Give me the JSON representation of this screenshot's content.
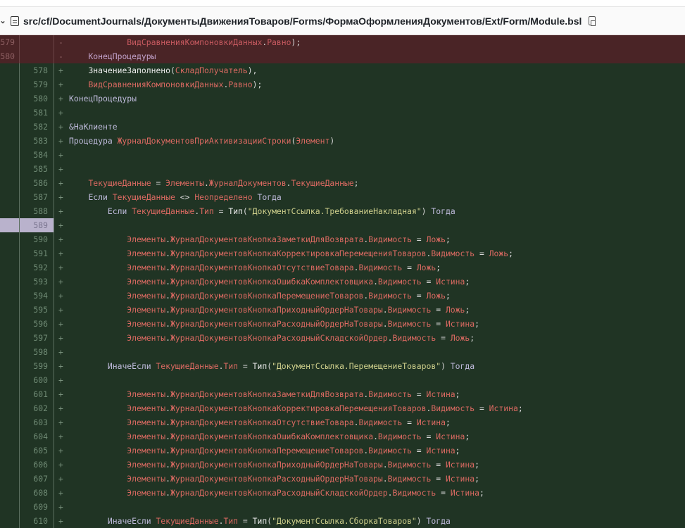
{
  "header": {
    "file_path": "src/cf/DocumentJournals/ДокументыДвиженияТоваров/Forms/ФормаОформленияДокументов/Ext/Form/Module.bsl",
    "icons": [
      "chevron-down-icon",
      "file-icon",
      "copy-icon"
    ]
  },
  "colors": {
    "added_bg": "#203424",
    "deleted_bg": "#4a2426",
    "highlight": "#b9b2cc"
  },
  "lines": [
    {
      "type": "del",
      "old": "579",
      "new": "",
      "sign": "-",
      "indent": 3,
      "tokens": [
        [
          "v",
          "ВидСравненияКомпоновкиДанных"
        ],
        [
          "p",
          "."
        ],
        [
          "v",
          "Равно"
        ],
        [
          "p",
          ");"
        ]
      ]
    },
    {
      "type": "del",
      "old": "580",
      "new": "",
      "sign": "-",
      "indent": 1,
      "tokens": [
        [
          "k",
          "КонецПроцедуры"
        ]
      ]
    },
    {
      "type": "add",
      "old": "",
      "new": "578",
      "sign": "+",
      "indent": 1,
      "tokens": [
        [
          "f",
          "ЗначениеЗаполнено"
        ],
        [
          "p",
          "("
        ],
        [
          "v",
          "СкладПолучатель"
        ],
        [
          "p",
          "),"
        ]
      ]
    },
    {
      "type": "add",
      "old": "",
      "new": "579",
      "sign": "+",
      "indent": 1,
      "tokens": [
        [
          "v",
          "ВидСравненияКомпоновкиДанных"
        ],
        [
          "p",
          "."
        ],
        [
          "v",
          "Равно"
        ],
        [
          "p",
          ");"
        ]
      ]
    },
    {
      "type": "add",
      "old": "",
      "new": "580",
      "sign": "+",
      "indent": 0,
      "tokens": [
        [
          "k",
          "КонецПроцедуры"
        ]
      ]
    },
    {
      "type": "add",
      "old": "",
      "new": "581",
      "sign": "+",
      "indent": 0,
      "tokens": []
    },
    {
      "type": "add",
      "old": "",
      "new": "582",
      "sign": "+",
      "indent": 0,
      "tokens": [
        [
          "k",
          "&НаКлиенте"
        ]
      ]
    },
    {
      "type": "add",
      "old": "",
      "new": "583",
      "sign": "+",
      "indent": 0,
      "tokens": [
        [
          "k",
          "Процедура "
        ],
        [
          "v",
          "ЖурналДокументовПриАктивизацииСтроки"
        ],
        [
          "p",
          "("
        ],
        [
          "v",
          "Элемент"
        ],
        [
          "p",
          ")"
        ]
      ]
    },
    {
      "type": "add",
      "old": "",
      "new": "584",
      "sign": "+",
      "indent": 0,
      "tokens": []
    },
    {
      "type": "add",
      "old": "",
      "new": "585",
      "sign": "+",
      "indent": 0,
      "tokens": []
    },
    {
      "type": "add",
      "old": "",
      "new": "586",
      "sign": "+",
      "indent": 1,
      "tokens": [
        [
          "v",
          "ТекущиеДанные"
        ],
        [
          "p",
          " = "
        ],
        [
          "v",
          "Элементы"
        ],
        [
          "p",
          "."
        ],
        [
          "v",
          "ЖурналДокументов"
        ],
        [
          "p",
          "."
        ],
        [
          "v",
          "ТекущиеДанные"
        ],
        [
          "p",
          ";"
        ]
      ]
    },
    {
      "type": "add",
      "old": "",
      "new": "587",
      "sign": "+",
      "indent": 1,
      "tokens": [
        [
          "k",
          "Если "
        ],
        [
          "v",
          "ТекущиеДанные"
        ],
        [
          "p",
          " <> "
        ],
        [
          "v",
          "Неопределено"
        ],
        [
          "k",
          " Тогда"
        ]
      ]
    },
    {
      "type": "add",
      "old": "",
      "new": "588",
      "sign": "+",
      "indent": 2,
      "tokens": [
        [
          "k",
          "Если "
        ],
        [
          "v",
          "ТекущиеДанные"
        ],
        [
          "p",
          "."
        ],
        [
          "v",
          "Тип"
        ],
        [
          "p",
          " = "
        ],
        [
          "f",
          "Тип"
        ],
        [
          "p",
          "("
        ],
        [
          "s",
          "\"ДокументСсылка.ТребованиеНакладная\""
        ],
        [
          "p",
          ")"
        ],
        [
          "k",
          " Тогда"
        ]
      ]
    },
    {
      "type": "add",
      "hl": true,
      "old": "",
      "new": "589",
      "sign": "+",
      "indent": 0,
      "tokens": []
    },
    {
      "type": "add",
      "old": "",
      "new": "590",
      "sign": "+",
      "indent": 3,
      "tokens": [
        [
          "v",
          "Элементы"
        ],
        [
          "p",
          "."
        ],
        [
          "v",
          "ЖурналДокументовКнопкаЗаметкиДляВозврата"
        ],
        [
          "p",
          "."
        ],
        [
          "v",
          "Видимость"
        ],
        [
          "p",
          " = "
        ],
        [
          "v",
          "Ложь"
        ],
        [
          "p",
          ";"
        ]
      ]
    },
    {
      "type": "add",
      "old": "",
      "new": "591",
      "sign": "+",
      "indent": 3,
      "tokens": [
        [
          "v",
          "Элементы"
        ],
        [
          "p",
          "."
        ],
        [
          "v",
          "ЖурналДокументовКнопкаКорректировкаПеремещенияТоваров"
        ],
        [
          "p",
          "."
        ],
        [
          "v",
          "Видимость"
        ],
        [
          "p",
          " = "
        ],
        [
          "v",
          "Ложь"
        ],
        [
          "p",
          ";"
        ]
      ]
    },
    {
      "type": "add",
      "old": "",
      "new": "592",
      "sign": "+",
      "indent": 3,
      "tokens": [
        [
          "v",
          "Элементы"
        ],
        [
          "p",
          "."
        ],
        [
          "v",
          "ЖурналДокументовКнопкаОтсутствиеТовара"
        ],
        [
          "p",
          "."
        ],
        [
          "v",
          "Видимость"
        ],
        [
          "p",
          " = "
        ],
        [
          "v",
          "Ложь"
        ],
        [
          "p",
          ";"
        ]
      ]
    },
    {
      "type": "add",
      "old": "",
      "new": "593",
      "sign": "+",
      "indent": 3,
      "tokens": [
        [
          "v",
          "Элементы"
        ],
        [
          "p",
          "."
        ],
        [
          "v",
          "ЖурналДокументовКнопкаОшибкаКомплектовщика"
        ],
        [
          "p",
          "."
        ],
        [
          "v",
          "Видимость"
        ],
        [
          "p",
          " = "
        ],
        [
          "v",
          "Истина"
        ],
        [
          "p",
          ";"
        ]
      ]
    },
    {
      "type": "add",
      "old": "",
      "new": "594",
      "sign": "+",
      "indent": 3,
      "tokens": [
        [
          "v",
          "Элементы"
        ],
        [
          "p",
          "."
        ],
        [
          "v",
          "ЖурналДокументовКнопкаПеремещениеТоваров"
        ],
        [
          "p",
          "."
        ],
        [
          "v",
          "Видимость"
        ],
        [
          "p",
          " = "
        ],
        [
          "v",
          "Ложь"
        ],
        [
          "p",
          ";"
        ]
      ]
    },
    {
      "type": "add",
      "old": "",
      "new": "595",
      "sign": "+",
      "indent": 3,
      "tokens": [
        [
          "v",
          "Элементы"
        ],
        [
          "p",
          "."
        ],
        [
          "v",
          "ЖурналДокументовКнопкаПриходныйОрдерНаТовары"
        ],
        [
          "p",
          "."
        ],
        [
          "v",
          "Видимость"
        ],
        [
          "p",
          " = "
        ],
        [
          "v",
          "Ложь"
        ],
        [
          "p",
          ";"
        ]
      ]
    },
    {
      "type": "add",
      "old": "",
      "new": "596",
      "sign": "+",
      "indent": 3,
      "tokens": [
        [
          "v",
          "Элементы"
        ],
        [
          "p",
          "."
        ],
        [
          "v",
          "ЖурналДокументовКнопкаРасходныйОрдерНаТовары"
        ],
        [
          "p",
          "."
        ],
        [
          "v",
          "Видимость"
        ],
        [
          "p",
          " = "
        ],
        [
          "v",
          "Истина"
        ],
        [
          "p",
          ";"
        ]
      ]
    },
    {
      "type": "add",
      "old": "",
      "new": "597",
      "sign": "+",
      "indent": 3,
      "tokens": [
        [
          "v",
          "Элементы"
        ],
        [
          "p",
          "."
        ],
        [
          "v",
          "ЖурналДокументовКнопкаРасходныйСкладскойОрдер"
        ],
        [
          "p",
          "."
        ],
        [
          "v",
          "Видимость"
        ],
        [
          "p",
          " = "
        ],
        [
          "v",
          "Ложь"
        ],
        [
          "p",
          ";"
        ]
      ]
    },
    {
      "type": "add",
      "old": "",
      "new": "598",
      "sign": "+",
      "indent": 0,
      "tokens": []
    },
    {
      "type": "add",
      "old": "",
      "new": "599",
      "sign": "+",
      "indent": 2,
      "tokens": [
        [
          "k",
          "ИначеЕсли "
        ],
        [
          "v",
          "ТекущиеДанные"
        ],
        [
          "p",
          "."
        ],
        [
          "v",
          "Тип"
        ],
        [
          "p",
          " = "
        ],
        [
          "f",
          "Тип"
        ],
        [
          "p",
          "("
        ],
        [
          "s",
          "\"ДокументСсылка.ПеремещениеТоваров\""
        ],
        [
          "p",
          ")"
        ],
        [
          "k",
          " Тогда"
        ]
      ]
    },
    {
      "type": "add",
      "old": "",
      "new": "600",
      "sign": "+",
      "indent": 0,
      "tokens": []
    },
    {
      "type": "add",
      "old": "",
      "new": "601",
      "sign": "+",
      "indent": 3,
      "tokens": [
        [
          "v",
          "Элементы"
        ],
        [
          "p",
          "."
        ],
        [
          "v",
          "ЖурналДокументовКнопкаЗаметкиДляВозврата"
        ],
        [
          "p",
          "."
        ],
        [
          "v",
          "Видимость"
        ],
        [
          "p",
          " = "
        ],
        [
          "v",
          "Истина"
        ],
        [
          "p",
          ";"
        ]
      ]
    },
    {
      "type": "add",
      "old": "",
      "new": "602",
      "sign": "+",
      "indent": 3,
      "tokens": [
        [
          "v",
          "Элементы"
        ],
        [
          "p",
          "."
        ],
        [
          "v",
          "ЖурналДокументовКнопкаКорректировкаПеремещенияТоваров"
        ],
        [
          "p",
          "."
        ],
        [
          "v",
          "Видимость"
        ],
        [
          "p",
          " = "
        ],
        [
          "v",
          "Истина"
        ],
        [
          "p",
          ";"
        ]
      ]
    },
    {
      "type": "add",
      "old": "",
      "new": "603",
      "sign": "+",
      "indent": 3,
      "tokens": [
        [
          "v",
          "Элементы"
        ],
        [
          "p",
          "."
        ],
        [
          "v",
          "ЖурналДокументовКнопкаОтсутствиеТовара"
        ],
        [
          "p",
          "."
        ],
        [
          "v",
          "Видимость"
        ],
        [
          "p",
          " = "
        ],
        [
          "v",
          "Истина"
        ],
        [
          "p",
          ";"
        ]
      ]
    },
    {
      "type": "add",
      "old": "",
      "new": "604",
      "sign": "+",
      "indent": 3,
      "tokens": [
        [
          "v",
          "Элементы"
        ],
        [
          "p",
          "."
        ],
        [
          "v",
          "ЖурналДокументовКнопкаОшибкаКомплектовщика"
        ],
        [
          "p",
          "."
        ],
        [
          "v",
          "Видимость"
        ],
        [
          "p",
          " = "
        ],
        [
          "v",
          "Истина"
        ],
        [
          "p",
          ";"
        ]
      ]
    },
    {
      "type": "add",
      "old": "",
      "new": "605",
      "sign": "+",
      "indent": 3,
      "tokens": [
        [
          "v",
          "Элементы"
        ],
        [
          "p",
          "."
        ],
        [
          "v",
          "ЖурналДокументовКнопкаПеремещениеТоваров"
        ],
        [
          "p",
          "."
        ],
        [
          "v",
          "Видимость"
        ],
        [
          "p",
          " = "
        ],
        [
          "v",
          "Истина"
        ],
        [
          "p",
          ";"
        ]
      ]
    },
    {
      "type": "add",
      "old": "",
      "new": "606",
      "sign": "+",
      "indent": 3,
      "tokens": [
        [
          "v",
          "Элементы"
        ],
        [
          "p",
          "."
        ],
        [
          "v",
          "ЖурналДокументовКнопкаПриходныйОрдерНаТовары"
        ],
        [
          "p",
          "."
        ],
        [
          "v",
          "Видимость"
        ],
        [
          "p",
          " = "
        ],
        [
          "v",
          "Истина"
        ],
        [
          "p",
          ";"
        ]
      ]
    },
    {
      "type": "add",
      "old": "",
      "new": "607",
      "sign": "+",
      "indent": 3,
      "tokens": [
        [
          "v",
          "Элементы"
        ],
        [
          "p",
          "."
        ],
        [
          "v",
          "ЖурналДокументовКнопкаРасходныйОрдерНаТовары"
        ],
        [
          "p",
          "."
        ],
        [
          "v",
          "Видимость"
        ],
        [
          "p",
          " = "
        ],
        [
          "v",
          "Истина"
        ],
        [
          "p",
          ";"
        ]
      ]
    },
    {
      "type": "add",
      "old": "",
      "new": "608",
      "sign": "+",
      "indent": 3,
      "tokens": [
        [
          "v",
          "Элементы"
        ],
        [
          "p",
          "."
        ],
        [
          "v",
          "ЖурналДокументовКнопкаРасходныйСкладскойОрдер"
        ],
        [
          "p",
          "."
        ],
        [
          "v",
          "Видимость"
        ],
        [
          "p",
          " = "
        ],
        [
          "v",
          "Истина"
        ],
        [
          "p",
          ";"
        ]
      ]
    },
    {
      "type": "add",
      "old": "",
      "new": "609",
      "sign": "+",
      "indent": 0,
      "tokens": []
    },
    {
      "type": "add",
      "old": "",
      "new": "610",
      "sign": "+",
      "indent": 2,
      "tokens": [
        [
          "k",
          "ИначеЕсли "
        ],
        [
          "v",
          "ТекущиеДанные"
        ],
        [
          "p",
          "."
        ],
        [
          "v",
          "Тип"
        ],
        [
          "p",
          " = "
        ],
        [
          "f",
          "Тип"
        ],
        [
          "p",
          "("
        ],
        [
          "s",
          "\"ДокументСсылка.СборкаТоваров\""
        ],
        [
          "p",
          ")"
        ],
        [
          "k",
          " Тогда"
        ]
      ]
    }
  ]
}
